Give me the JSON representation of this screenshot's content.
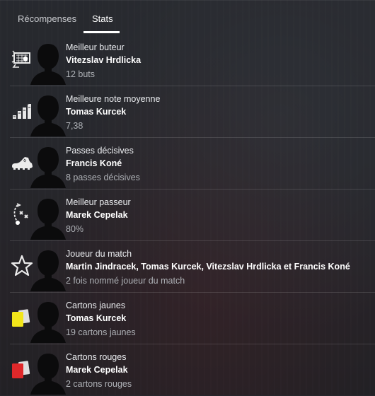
{
  "tabs": [
    {
      "label": "Récompenses",
      "active": false
    },
    {
      "label": "Stats",
      "active": true
    }
  ],
  "rows": [
    {
      "icon": "goal-net-icon",
      "label": "Meilleur buteur",
      "name": "Vitezslav Hrdlicka",
      "value": "12 buts"
    },
    {
      "icon": "rating-bars-icon",
      "label": "Meilleure note moyenne",
      "name": "Tomas Kurcek",
      "value": "7,38"
    },
    {
      "icon": "boot-icon",
      "label": "Passes décisives",
      "name": "Francis Koné",
      "value": "8 passes décisives"
    },
    {
      "icon": "tactics-pass-icon",
      "label": "Meilleur passeur",
      "name": "Marek Cepelak",
      "value": "80%"
    },
    {
      "icon": "star-icon",
      "label": "Joueur du match",
      "name": "Martin Jindracek, Tomas Kurcek, Vitezslav Hrdlicka et Francis Koné",
      "value": "2 fois nommé joueur du match"
    },
    {
      "icon": "yellow-card-icon",
      "label": "Cartons jaunes",
      "name": "Tomas Kurcek",
      "value": "19 cartons jaunes"
    },
    {
      "icon": "red-card-icon",
      "label": "Cartons rouges",
      "name": "Marek Cepelak",
      "value": "2 cartons rouges"
    }
  ],
  "colors": {
    "yellow_card": "#f2e51a",
    "red_card": "#e0282a",
    "tab_underline": "#ffffff"
  }
}
